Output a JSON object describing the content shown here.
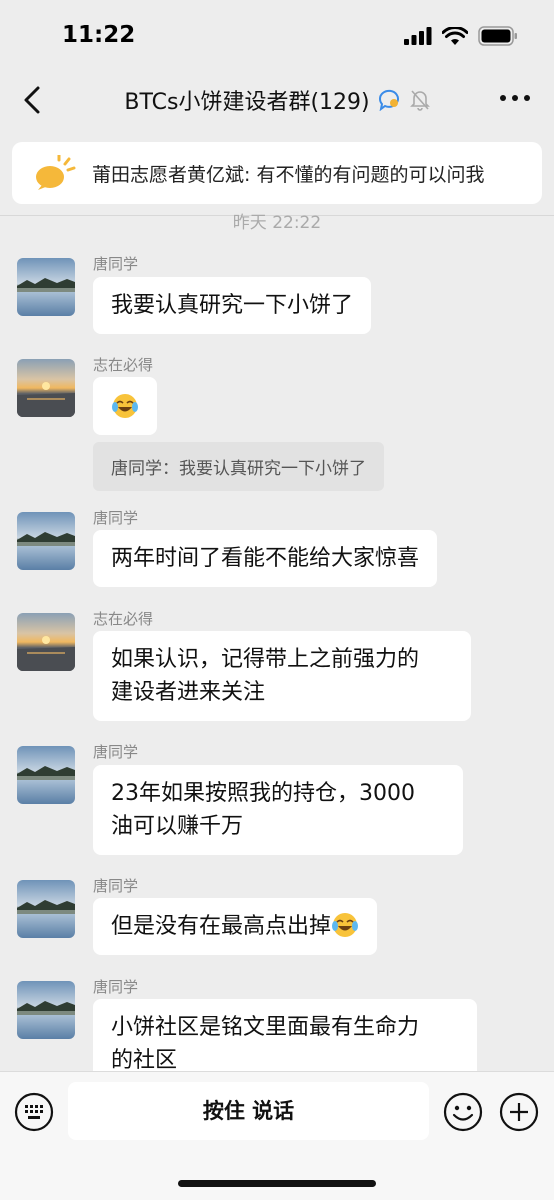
{
  "status_bar": {
    "time": "11:22"
  },
  "nav": {
    "title": "BTCs小饼建设者群(129)"
  },
  "notice": {
    "text": "莆田志愿者黄亿斌: 有不懂的有问题的可以问我"
  },
  "timestamp": "昨天 22:22",
  "messages": [
    {
      "sender": "唐同学",
      "text": "我要认真研究一下小饼了"
    },
    {
      "sender": "志在必得",
      "text": "",
      "quote": "唐同学：我要认真研究一下小饼了"
    },
    {
      "sender": "唐同学",
      "text": "两年时间了看能不能给大家惊喜"
    },
    {
      "sender": "志在必得",
      "line1": "如果认识，记得带上之前强力的",
      "line2": "建设者进来关注"
    },
    {
      "sender": "唐同学",
      "line1": "23年如果按照我的持仓，3000",
      "line2": "油可以赚千万"
    },
    {
      "sender": "唐同学",
      "text": "但是没有在最高点出掉"
    },
    {
      "sender": "唐同学",
      "line1": "小饼社区是铭文里面最有生命力",
      "line2": "的社区"
    }
  ],
  "input_bar": {
    "voice_label": "按住 说话"
  }
}
